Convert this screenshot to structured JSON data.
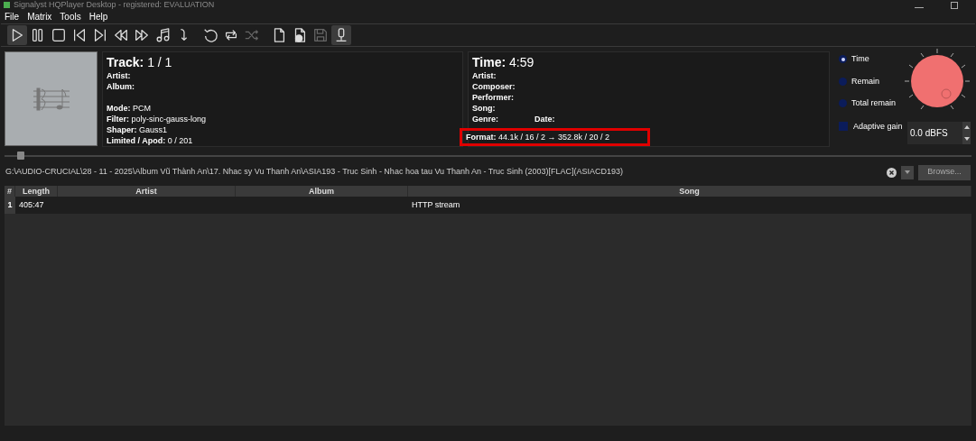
{
  "window": {
    "title": "Signalyst HQPlayer Desktop - registered: EVALUATION"
  },
  "menu": [
    "File",
    "Matrix",
    "Tools",
    "Help"
  ],
  "toolbar": [
    {
      "kind": "play",
      "selected": true,
      "disabled": false
    },
    {
      "kind": "pause",
      "selected": false,
      "disabled": false
    },
    {
      "kind": "stop",
      "selected": false,
      "disabled": false
    },
    {
      "kind": "prev",
      "selected": false,
      "disabled": false
    },
    {
      "kind": "next",
      "selected": false,
      "disabled": false
    },
    {
      "kind": "rewind",
      "selected": false,
      "disabled": false
    },
    {
      "kind": "forward",
      "selected": false,
      "disabled": false
    },
    {
      "kind": "note",
      "selected": false,
      "disabled": false
    },
    {
      "kind": "jump",
      "selected": false,
      "disabled": false
    },
    {
      "kind": "undo",
      "selected": false,
      "disabled": false
    },
    {
      "kind": "repeat",
      "selected": false,
      "disabled": false
    },
    {
      "kind": "shuffle",
      "selected": false,
      "disabled": true
    },
    {
      "kind": "file",
      "selected": false,
      "disabled": false
    },
    {
      "kind": "fileopen",
      "selected": false,
      "disabled": false
    },
    {
      "kind": "save",
      "selected": false,
      "disabled": true
    },
    {
      "kind": "meter",
      "selected": true,
      "disabled": false
    }
  ],
  "track": {
    "heading": "Track:",
    "value": "1 / 1",
    "fields": [
      {
        "label": "Artist:"
      },
      {
        "label": "Album:"
      }
    ],
    "details": [
      {
        "label": "Mode:",
        "value": "PCM"
      },
      {
        "label": "Filter:",
        "value": "poly-sinc-gauss-long"
      },
      {
        "label": "Shaper:",
        "value": "Gauss1"
      },
      {
        "label": "Limited / Apod:",
        "value": "0 / 201"
      }
    ]
  },
  "time": {
    "heading": "Time:",
    "value": "4:59",
    "fields": [
      "Artist:",
      "Composer:",
      "Performer:",
      "Song:"
    ],
    "genre": "Genre:",
    "date": "Date:",
    "format": {
      "label": "Format:",
      "value": "44.1k / 16 / 2 → 352.8k / 20 / 2",
      "highlighted": true
    }
  },
  "display_mode": [
    {
      "label": "Time",
      "selected": true
    },
    {
      "label": "Remain",
      "selected": false
    },
    {
      "label": "Total remain",
      "selected": false
    }
  ],
  "adaptive_gain": {
    "label": "Adaptive gain",
    "checked": false
  },
  "volume": {
    "value": "0.0 dBFS"
  },
  "position": {
    "level": 0.01
  },
  "path": {
    "value": "G:\\AUDIO-CRUCIAL\\28 - 11 - 2025\\Album  Vũ Thành An\\17. Nhac sy Vu Thanh An\\ASIA193 - Truc Sinh - Nhac hoa tau Vu Thanh An - Truc Sinh (2003)[FLAC](ASIACD193)",
    "browse": "Browse..."
  },
  "table": {
    "columns": [
      "#",
      "Length",
      "Artist",
      "Album",
      "Song"
    ],
    "rows": [
      {
        "cells": [
          "1",
          "405:47",
          "",
          "",
          "HTTP stream"
        ],
        "selected": true
      }
    ]
  }
}
